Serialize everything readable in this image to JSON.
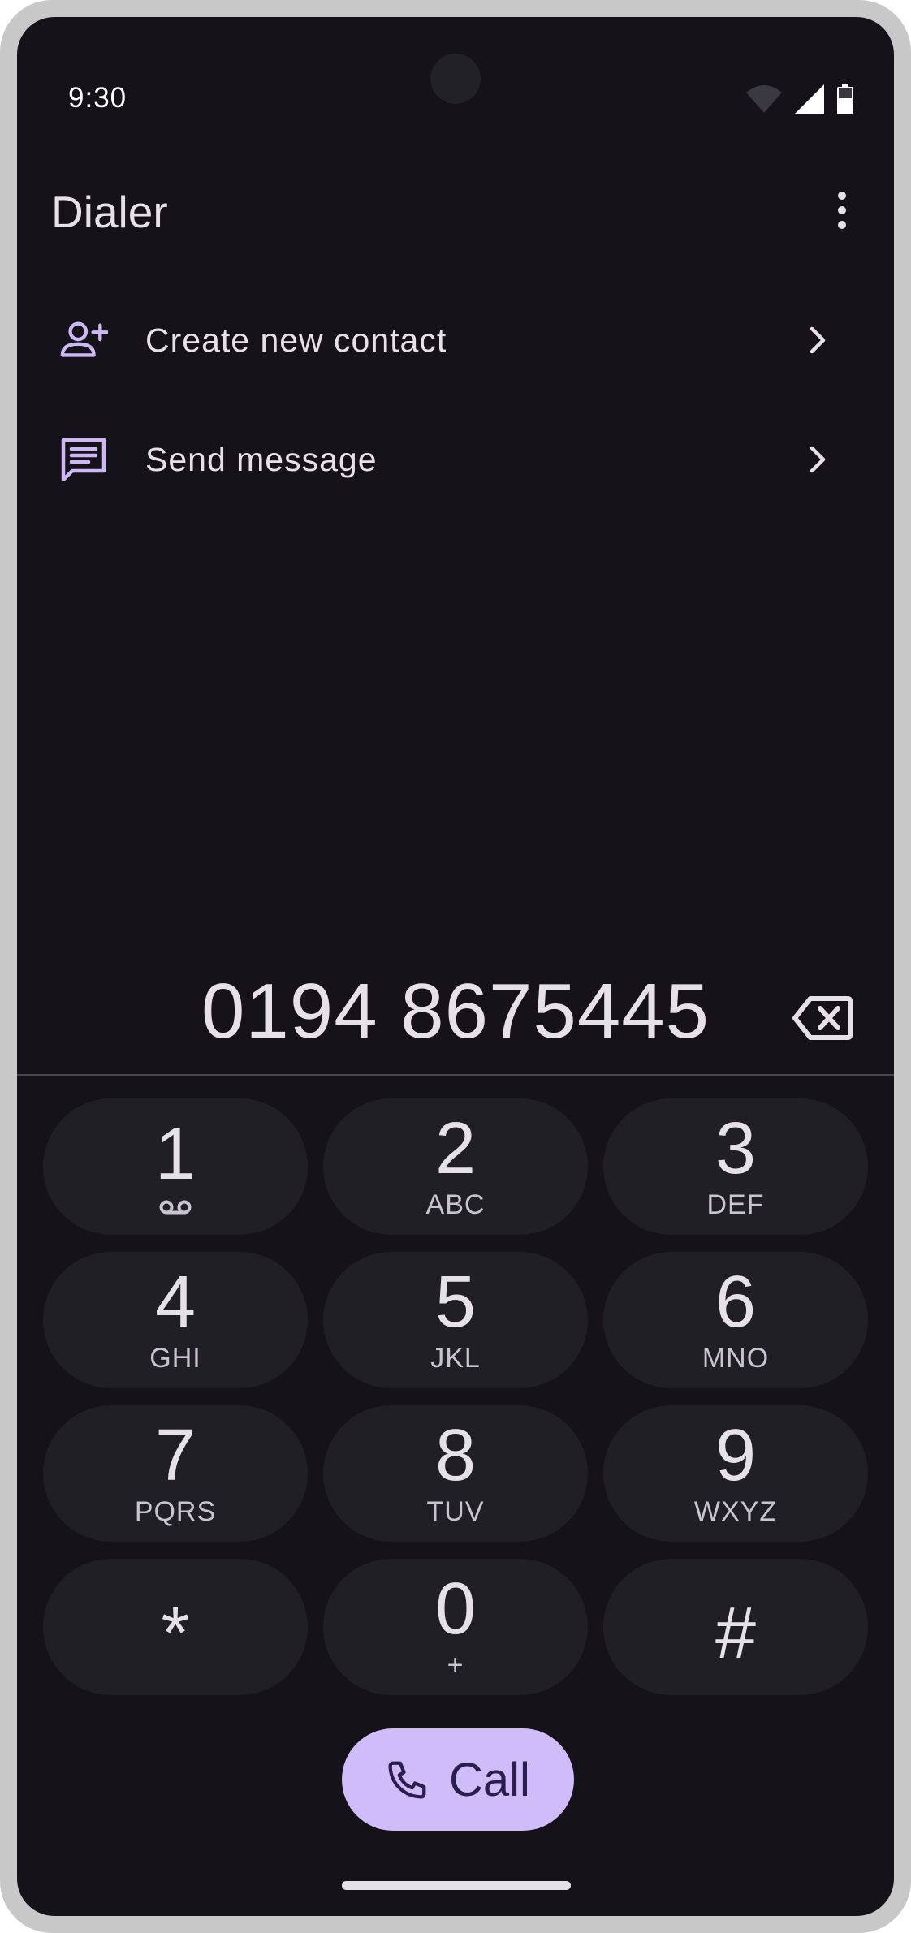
{
  "status_bar": {
    "time": "9:30"
  },
  "app_bar": {
    "title": "Dialer",
    "more_icon": "more-vert-icon"
  },
  "actions": [
    {
      "label": "Create new contact",
      "icon": "person-add-icon"
    },
    {
      "label": "Send message",
      "icon": "message-icon"
    }
  ],
  "display": {
    "number": "0194 8675445"
  },
  "keypad": [
    {
      "digit": "1",
      "letters": "",
      "sub_icon": "voicemail-icon"
    },
    {
      "digit": "2",
      "letters": "ABC"
    },
    {
      "digit": "3",
      "letters": "DEF"
    },
    {
      "digit": "4",
      "letters": "GHI"
    },
    {
      "digit": "5",
      "letters": "JKL"
    },
    {
      "digit": "6",
      "letters": "MNO"
    },
    {
      "digit": "7",
      "letters": "PQRS"
    },
    {
      "digit": "8",
      "letters": "TUV"
    },
    {
      "digit": "9",
      "letters": "WXYZ"
    },
    {
      "digit": "*",
      "letters": ""
    },
    {
      "digit": "0",
      "letters": "+"
    },
    {
      "digit": "#",
      "letters": ""
    }
  ],
  "call_button": {
    "label": "Call",
    "icon": "phone-icon"
  },
  "colors": {
    "background": "#151319",
    "key_background": "#211f26",
    "accent": "#cfbcf8",
    "icon_accent": "#cdb8f5",
    "text": "#e6e1e9"
  }
}
